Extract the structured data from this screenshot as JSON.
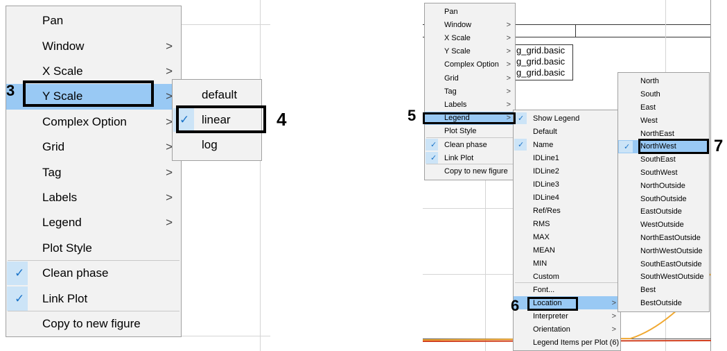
{
  "left_menu": {
    "items": [
      {
        "label": "Pan",
        "arrow": false,
        "checked": false
      },
      {
        "label": "Window",
        "arrow": true,
        "checked": false
      },
      {
        "label": "X Scale",
        "arrow": true,
        "checked": false
      },
      {
        "label": "Y Scale",
        "arrow": true,
        "checked": false,
        "highlighted": true
      },
      {
        "label": "Complex Option",
        "arrow": true,
        "checked": false
      },
      {
        "label": "Grid",
        "arrow": true,
        "checked": false
      },
      {
        "label": "Tag",
        "arrow": true,
        "checked": false
      },
      {
        "label": "Labels",
        "arrow": true,
        "checked": false
      },
      {
        "label": "Legend",
        "arrow": true,
        "checked": false
      },
      {
        "label": "Plot Style",
        "arrow": false,
        "checked": false
      },
      {
        "label": "Clean phase",
        "arrow": false,
        "checked": true
      },
      {
        "label": "Link Plot",
        "arrow": false,
        "checked": true
      },
      {
        "label": "Copy to new figure",
        "arrow": false,
        "checked": false
      }
    ],
    "arrow_glyph": ">",
    "check_glyph": "✓"
  },
  "yscale_submenu": {
    "items": [
      {
        "label": "default",
        "checked": false
      },
      {
        "label": "linear",
        "checked": true
      },
      {
        "label": "log",
        "checked": false
      }
    ]
  },
  "right_menu": {
    "items": [
      {
        "label": "Pan",
        "arrow": false,
        "checked": false
      },
      {
        "label": "Window",
        "arrow": true,
        "checked": false
      },
      {
        "label": "X Scale",
        "arrow": true,
        "checked": false
      },
      {
        "label": "Y Scale",
        "arrow": true,
        "checked": false
      },
      {
        "label": "Complex Option",
        "arrow": true,
        "checked": false
      },
      {
        "label": "Grid",
        "arrow": true,
        "checked": false
      },
      {
        "label": "Tag",
        "arrow": true,
        "checked": false
      },
      {
        "label": "Labels",
        "arrow": true,
        "checked": false
      },
      {
        "label": "Legend",
        "arrow": true,
        "checked": false,
        "highlighted": true
      },
      {
        "label": "Plot Style",
        "arrow": false,
        "checked": false
      },
      {
        "label": "Clean phase",
        "arrow": false,
        "checked": true
      },
      {
        "label": "Link Plot",
        "arrow": false,
        "checked": true
      },
      {
        "label": "Copy to new figure",
        "arrow": false,
        "checked": false
      }
    ]
  },
  "legend_submenu": {
    "items": [
      {
        "label": "Show Legend",
        "checked": true,
        "arrow": false
      },
      {
        "label": "Default",
        "checked": false,
        "arrow": false
      },
      {
        "label": "Name",
        "checked": true,
        "arrow": false
      },
      {
        "label": "IDLine1",
        "checked": false,
        "arrow": false
      },
      {
        "label": "IDLine2",
        "checked": false,
        "arrow": false
      },
      {
        "label": "IDLine3",
        "checked": false,
        "arrow": false
      },
      {
        "label": "IDLine4",
        "checked": false,
        "arrow": false
      },
      {
        "label": "Ref/Res",
        "checked": false,
        "arrow": false
      },
      {
        "label": "RMS",
        "checked": false,
        "arrow": false
      },
      {
        "label": "MAX",
        "checked": false,
        "arrow": false
      },
      {
        "label": "MEAN",
        "checked": false,
        "arrow": false
      },
      {
        "label": "MIN",
        "checked": false,
        "arrow": false
      },
      {
        "label": "Custom",
        "checked": false,
        "arrow": false
      },
      {
        "label": "Font...",
        "checked": false,
        "arrow": false
      },
      {
        "label": "Location",
        "checked": false,
        "arrow": true,
        "highlighted": true
      },
      {
        "label": "Interpreter",
        "checked": false,
        "arrow": true
      },
      {
        "label": "Orientation",
        "checked": false,
        "arrow": true
      },
      {
        "label": "Legend Items per Plot (6)",
        "checked": false,
        "arrow": false
      }
    ]
  },
  "location_submenu": {
    "items": [
      {
        "label": "North",
        "checked": false
      },
      {
        "label": "South",
        "checked": false
      },
      {
        "label": "East",
        "checked": false
      },
      {
        "label": "West",
        "checked": false
      },
      {
        "label": "NorthEast",
        "checked": false
      },
      {
        "label": "NorthWest",
        "checked": true,
        "highlighted": true
      },
      {
        "label": "SouthEast",
        "checked": false
      },
      {
        "label": "SouthWest",
        "checked": false
      },
      {
        "label": "NorthOutside",
        "checked": false
      },
      {
        "label": "SouthOutside",
        "checked": false
      },
      {
        "label": "EastOutside",
        "checked": false
      },
      {
        "label": "WestOutside",
        "checked": false
      },
      {
        "label": "NorthEastOutside",
        "checked": false
      },
      {
        "label": "NorthWestOutside",
        "checked": false
      },
      {
        "label": "SouthEastOutside",
        "checked": false
      },
      {
        "label": "SouthWestOutside",
        "checked": false
      },
      {
        "label": "Best",
        "checked": false
      },
      {
        "label": "BestOutside",
        "checked": false
      }
    ]
  },
  "legend_box_texts": [
    "g_grid.basic",
    "g_grid.basic",
    "g_grid.basic"
  ],
  "step_labels": {
    "s3": "3",
    "s4": "4",
    "s5": "5",
    "s6": "6",
    "s7": "7"
  },
  "colors": {
    "menu_bg": "#f2f2f2",
    "highlight": "#99c9f4",
    "check_bg": "#cce4f7",
    "check": "#1a73c8",
    "annotation_border": "#000000",
    "plot_line_orange": "#f0a830",
    "plot_line_red": "#d04020"
  }
}
